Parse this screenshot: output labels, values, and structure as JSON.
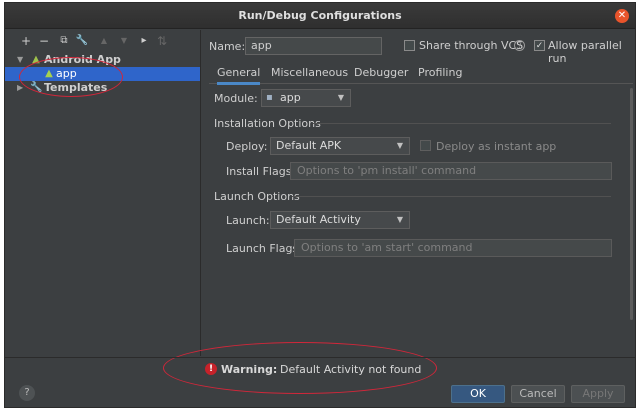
{
  "window": {
    "title": "Run/Debug Configurations",
    "close_glyph": "✕"
  },
  "toolbar": {
    "add": "+",
    "remove": "−",
    "copy": "⧉",
    "edit": "🔧",
    "up": "▲",
    "down": "▼",
    "folder": "▸",
    "sort": "⇅"
  },
  "tree": {
    "android_app": "Android App",
    "app": "app",
    "templates": "Templates"
  },
  "name": {
    "label": "Name:",
    "value": "app"
  },
  "share": {
    "label": "Share through VCS",
    "checked": false
  },
  "parallel": {
    "label": "Allow parallel run",
    "checked": true,
    "check_glyph": "✓"
  },
  "tabs": [
    "General",
    "Miscellaneous",
    "Debugger",
    "Profiling"
  ],
  "module": {
    "label": "Module:",
    "value": "app"
  },
  "install": {
    "section": "Installation Options",
    "deploy_label": "Deploy:",
    "deploy_value": "Default APK",
    "instant_label": "Deploy as instant app",
    "flags_label": "Install Flags:",
    "flags_placeholder": "Options to 'pm install' command"
  },
  "launch": {
    "section": "Launch Options",
    "launch_label": "Launch:",
    "launch_value": "Default Activity",
    "flags_label": "Launch Flags:",
    "flags_placeholder": "Options to 'am start' command"
  },
  "warning": {
    "bold": "Warning:",
    "text": "Default Activity not found"
  },
  "buttons": {
    "help": "?",
    "ok": "OK",
    "cancel": "Cancel",
    "apply": "Apply"
  },
  "colors": {
    "accent": "#2f65ca",
    "warning": "#c7222a",
    "annotation": "#d0273a"
  }
}
